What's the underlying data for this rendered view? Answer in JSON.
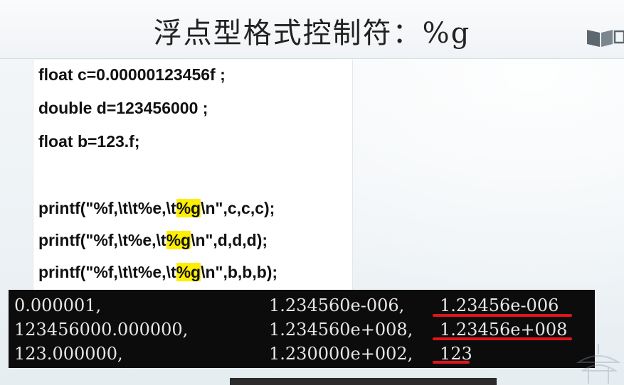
{
  "slide": {
    "title": "浮点型格式控制符：%g"
  },
  "code": {
    "line1": "float c=0.00000123456f ;",
    "line2": "double d=123456000 ;",
    "line3": "float b=123.f;",
    "line4_pre": "printf(\"%f,\\t\\t%e,\\t",
    "line4_hl": "%g",
    "line4_post": "\\n\",c,c,c);",
    "line5_pre": "printf(\"%f,\\t%e,\\t",
    "line5_hl": "%g",
    "line5_post": "\\n\",d,d,d);",
    "line6_pre": "printf(\"%f,\\t\\t%e,\\t",
    "line6_hl": "%g",
    "line6_post": "\\n\",b,b,b);"
  },
  "console": {
    "rows": [
      {
        "col1": "0.000001,",
        "col2": "1.234560e-006,",
        "col3": "1.23456e-006"
      },
      {
        "col1": "123456000.000000,",
        "col2": "1.234560e+008,",
        "col3": "1.23456e+008"
      },
      {
        "col1": "123.000000,",
        "col2": "1.230000e+002,",
        "col3": "123"
      }
    ]
  },
  "colors": {
    "highlight": "#ffee00",
    "underline": "#e0141c",
    "console_bg": "#0c0c0c"
  },
  "icons": [
    "book-logo-icon",
    "pavilion-watermark-icon"
  ]
}
